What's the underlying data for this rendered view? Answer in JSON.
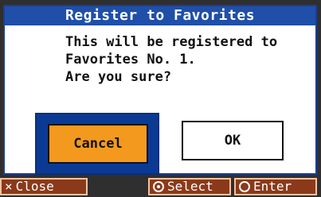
{
  "dialog": {
    "title": "Register to Favorites",
    "message": [
      "This will be registered to",
      "Favorites No. 1.",
      "Are you sure?"
    ],
    "buttons": {
      "cancel": "Cancel",
      "ok": "OK"
    }
  },
  "footer": {
    "close": {
      "icon": "close-x-icon",
      "label": "Close"
    },
    "select": {
      "icon": "dial-icon",
      "label": "Select"
    },
    "enter": {
      "icon": "enter-ring-icon",
      "label": "Enter"
    }
  },
  "colors": {
    "titlebar": "#1f4fa8",
    "selected_frame": "#0b3a95",
    "cancel_button": "#f39a1e",
    "footer_key": "#8a3a1a"
  }
}
